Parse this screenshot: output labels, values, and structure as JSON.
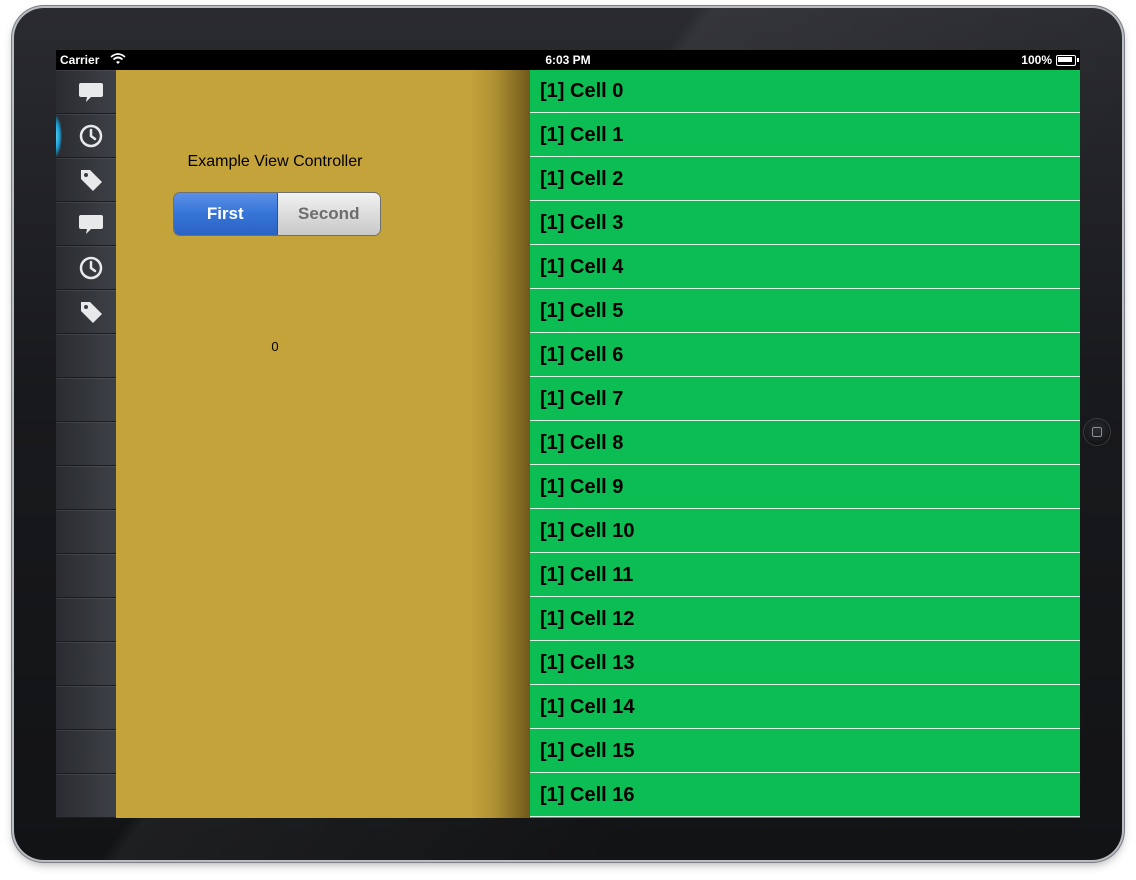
{
  "status_bar": {
    "carrier": "Carrier",
    "time": "6:03 PM",
    "battery": "100%"
  },
  "sidebar": {
    "items": [
      {
        "icon": "speech-bubble-icon",
        "active": false
      },
      {
        "icon": "clock-icon",
        "active": true
      },
      {
        "icon": "tag-icon",
        "active": false
      },
      {
        "icon": "speech-bubble-icon",
        "active": false
      },
      {
        "icon": "clock-icon",
        "active": false
      },
      {
        "icon": "tag-icon",
        "active": false
      }
    ],
    "empty_rows": 11
  },
  "left_panel": {
    "title": "Example View Controller",
    "segments": [
      "First",
      "Second"
    ],
    "selected_segment": "First",
    "counter": "0",
    "background": "#c4a33b"
  },
  "right_panel": {
    "background": "#0bbd52",
    "cells": [
      "[1] Cell 0",
      "[1] Cell 1",
      "[1] Cell 2",
      "[1] Cell 3",
      "[1] Cell 4",
      "[1] Cell 5",
      "[1] Cell 6",
      "[1] Cell 7",
      "[1] Cell 8",
      "[1] Cell 9",
      "[1] Cell 10",
      "[1] Cell 11",
      "[1] Cell 12",
      "[1] Cell 13",
      "[1] Cell 14",
      "[1] Cell 15",
      "[1] Cell 16"
    ]
  }
}
